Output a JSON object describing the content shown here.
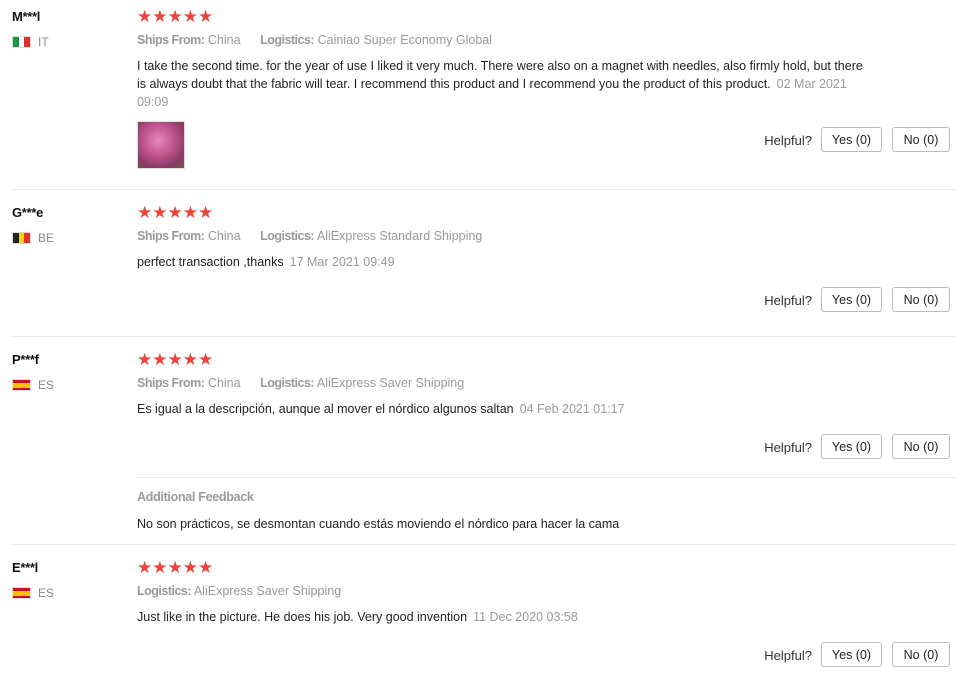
{
  "labels": {
    "ships_from": "Ships From:",
    "logistics": "Logistics:",
    "helpful": "Helpful?",
    "additional_feedback": "Additional Feedback"
  },
  "stars": "★★★★★",
  "reviews": [
    {
      "user": "M***l",
      "country": "IT",
      "rating": 5,
      "ships_from": "China",
      "logistics": "Cainiao Super Economy Global",
      "text": "I take the second time. for the year of use I liked it very much. There were also on a magnet with needles, also firmly hold, but there is always doubt that the fabric will tear. I recommend this product and I recommend you the product of this product.",
      "date": "02 Mar 2021 09:09",
      "yes": "Yes (0)",
      "no": "No (0)"
    },
    {
      "user": "G***e",
      "country": "BE",
      "rating": 5,
      "ships_from": "China",
      "logistics": "AliExpress Standard Shipping",
      "text": "perfect transaction ,thanks",
      "date": "17 Mar 2021 09:49",
      "yes": "Yes (0)",
      "no": "No (0)"
    },
    {
      "user": "P***f",
      "country": "ES",
      "rating": 5,
      "ships_from": "China",
      "logistics": "AliExpress Saver Shipping",
      "text": "Es igual a la descripción, aunque al mover el nórdico algunos saltan",
      "date": "04 Feb 2021 01:17",
      "yes": "Yes (0)",
      "no": "No (0)",
      "additional_feedback": "No son prácticos, se desmontan cuando estás moviendo el nórdico para hacer la cama"
    },
    {
      "user": "E***l",
      "country": "ES",
      "rating": 5,
      "logistics": "AliExpress Saver Shipping",
      "text": "Just like in the picture. He does his job. Very good invention",
      "date": "11 Dec 2020 03:58",
      "yes": "Yes (0)",
      "no": "No (0)"
    }
  ]
}
